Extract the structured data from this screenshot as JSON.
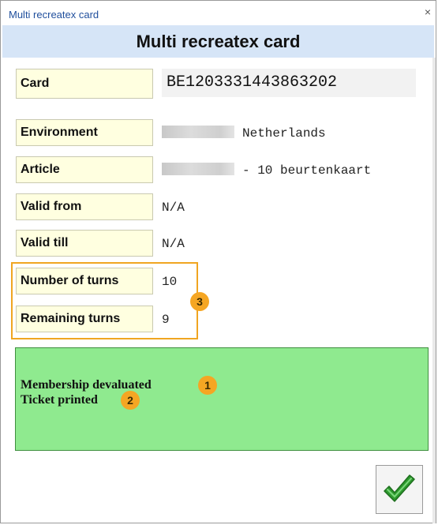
{
  "window": {
    "title": "Multi recreatex card",
    "close_label": "×"
  },
  "header": {
    "title": "Multi recreatex card"
  },
  "fields": {
    "card": {
      "label": "Card",
      "value": "BE1203331443863202"
    },
    "environment": {
      "label": "Environment",
      "value": "Netherlands"
    },
    "article": {
      "label": "Article",
      "value": "- 10 beurtenkaart"
    },
    "valid_from": {
      "label": "Valid from",
      "value": "N/A"
    },
    "valid_till": {
      "label": "Valid till",
      "value": "N/A"
    },
    "number_of_turns": {
      "label": "Number of turns",
      "value": "10"
    },
    "remaining_turns": {
      "label": "Remaining turns",
      "value": "9"
    }
  },
  "status": {
    "line1": "Membership devaluated",
    "line2": "Ticket printed",
    "background": "#8fea8f"
  },
  "callouts": {
    "one": "1",
    "two": "2",
    "three": "3",
    "color": "#f5a623"
  },
  "ok_button": {
    "icon": "checkmark-icon"
  }
}
